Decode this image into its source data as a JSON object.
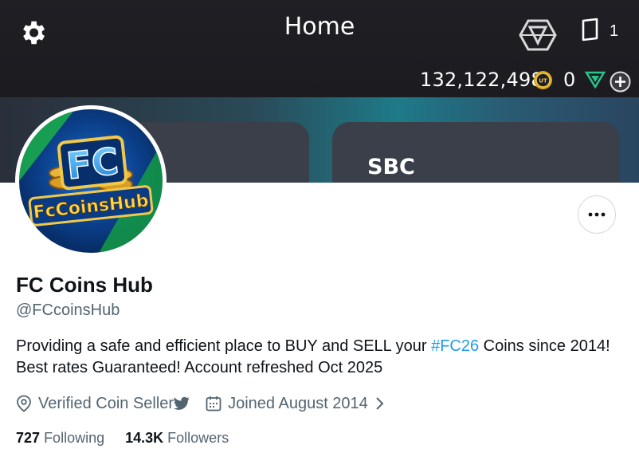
{
  "banner": {
    "title": "Home",
    "pack_count": "1",
    "coins": "132,122,498",
    "coin_badge": "UT",
    "points": "0",
    "tile_right_label": "SBC"
  },
  "profile": {
    "avatar_text_top": "FC",
    "avatar_text_bottom": "FcCoinsHub",
    "display_name": "FC Coins Hub",
    "handle": "@FCcoinsHub",
    "bio_before": "Providing a safe and efficient place to BUY and SELL your ",
    "bio_hashtag": "#FC26",
    "bio_after": " Coins since 2014! Best rates Guaranteed! Account refreshed Oct 2025",
    "location": "Verified Coin Seller",
    "joined": "Joined August 2014",
    "following_count": "727",
    "following_label": "Following",
    "followers_count": "14.3K",
    "followers_label": "Followers"
  },
  "colors": {
    "accent": "#1d9bf0",
    "text_primary": "#0f1419",
    "text_secondary": "#536471"
  }
}
